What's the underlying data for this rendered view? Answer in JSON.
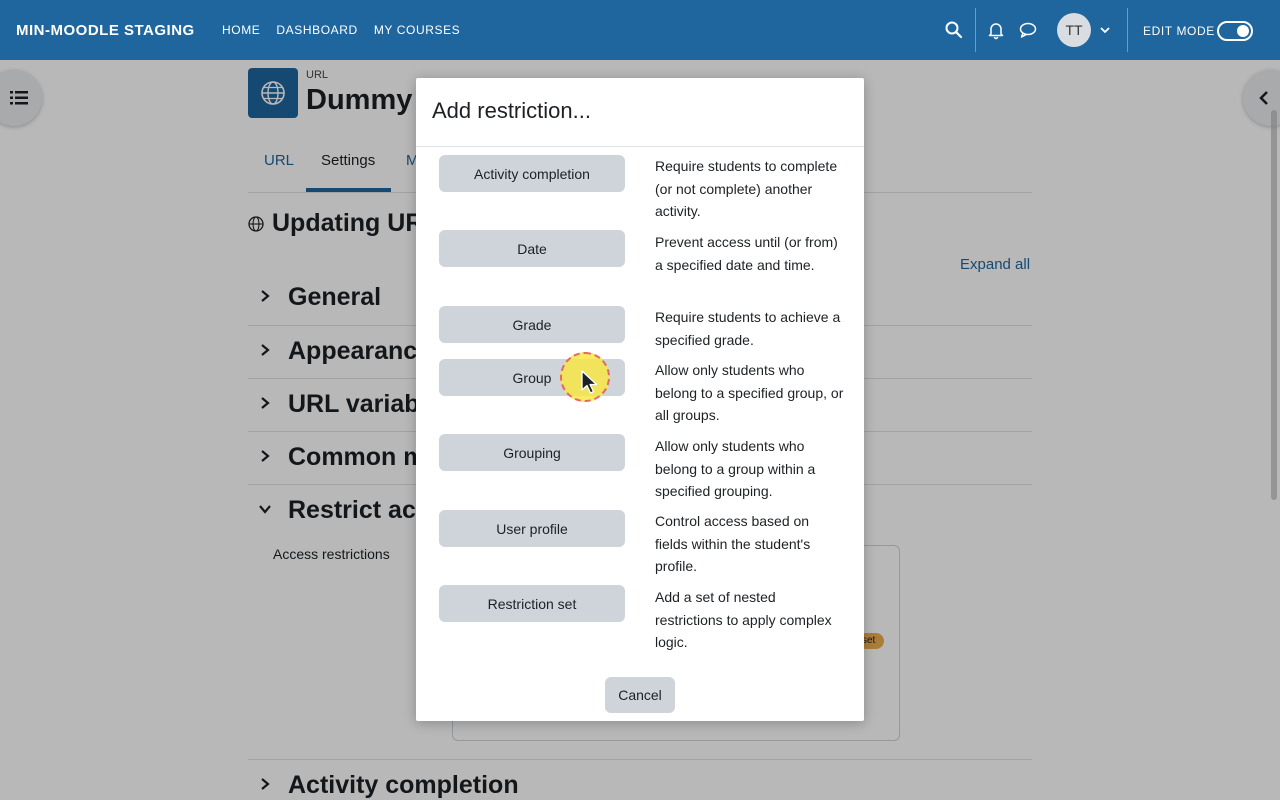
{
  "navbar": {
    "brand": "MIN-MOODLE STAGING",
    "links": [
      "HOME",
      "DASHBOARD",
      "MY COURSES"
    ],
    "avatar_initials": "TT",
    "edit_mode_label": "EDIT MODE",
    "edit_mode_on": true,
    "color": "#1f669e"
  },
  "page": {
    "module_type": "URL",
    "title": "Dummy",
    "tabs": [
      "URL",
      "Settings",
      "M"
    ],
    "active_tab": "Settings",
    "heading": "Updating UR",
    "expand_all": "Expand all",
    "sections": [
      "General",
      "Appearance",
      "URL variabl",
      "Common m",
      "Restrict acc",
      "Activity completion"
    ],
    "access_restrictions_label": "Access restrictions",
    "set_badge": "set"
  },
  "modal": {
    "title": "Add restriction...",
    "options": [
      {
        "label": "Activity completion",
        "description": "Require students to complete (or not complete) another activity."
      },
      {
        "label": "Date",
        "description": "Prevent access until (or from) a specified date and time."
      },
      {
        "label": "Grade",
        "description": "Require students to achieve a specified grade."
      },
      {
        "label": "Group",
        "description": "Allow only students who belong to a specified group, or all groups."
      },
      {
        "label": "Grouping",
        "description": "Allow only students who belong to a group within a specified grouping."
      },
      {
        "label": "User profile",
        "description": "Control access based on fields within the student's profile."
      },
      {
        "label": "Restriction set",
        "description": "Add a set of nested restrictions to apply complex logic."
      }
    ],
    "cancel_label": "Cancel"
  }
}
